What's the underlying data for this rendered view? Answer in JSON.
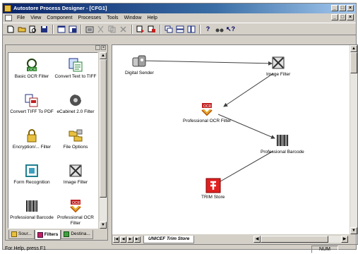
{
  "window": {
    "title": "Autostore Process Designer - [CFG1]",
    "minimize": "_",
    "restore": "□",
    "close": "×"
  },
  "menu": [
    "File",
    "View",
    "Component",
    "Processes",
    "Tools",
    "Window",
    "Help"
  ],
  "palette": {
    "items": [
      {
        "label": "Basic OCR Filter",
        "icon": "ocr-filter-icon"
      },
      {
        "label": "Convert Text to TIFF",
        "icon": "convert-text-icon"
      },
      {
        "label": "Convert TIFF To PDF",
        "icon": "convert-pdf-icon"
      },
      {
        "label": "eCabinet 2.0 Filter",
        "icon": "ecabinet-icon"
      },
      {
        "label": "Encryption/... Filter",
        "icon": "encryption-icon"
      },
      {
        "label": "File Options",
        "icon": "file-options-icon"
      },
      {
        "label": "Form Recognition",
        "icon": "form-recognition-icon"
      },
      {
        "label": "Image Filter",
        "icon": "image-filter-icon"
      },
      {
        "label": "Professional Barcode",
        "icon": "barcode-icon"
      },
      {
        "label": "Professional OCR Filter",
        "icon": "pro-ocr-icon"
      }
    ],
    "tabs": [
      "Sour...",
      "Filters",
      "Destina..."
    ],
    "active_tab": "Filters"
  },
  "canvas": {
    "nodes": [
      {
        "label": "Digital Sender",
        "icon": "digital-sender-icon"
      },
      {
        "label": "Image Filter",
        "icon": "image-filter-icon"
      },
      {
        "label": "Professional OCR Filter",
        "icon": "pro-ocr-icon"
      },
      {
        "label": "Professional Barcode",
        "icon": "barcode-icon"
      },
      {
        "label": "TRIM Store",
        "icon": "trim-store-icon"
      }
    ],
    "sheet_tab": "UNICEF Trim Store"
  },
  "status": {
    "message": "For Help, press F1",
    "num": "NUM"
  }
}
